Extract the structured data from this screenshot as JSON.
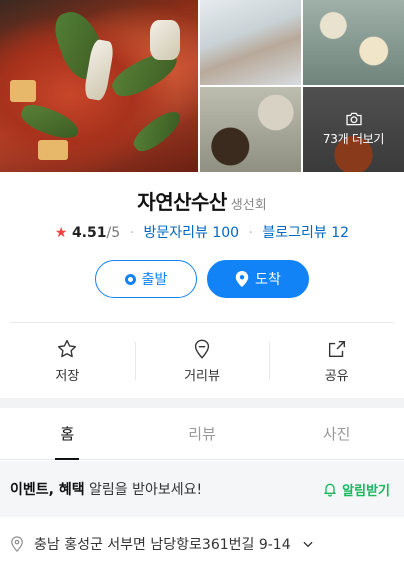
{
  "place": {
    "name": "자연산수산",
    "category": "생선회",
    "rating": "4.51",
    "rating_max": "/5",
    "visitor_reviews": "방문자리뷰 100",
    "blog_reviews": "블로그리뷰 12"
  },
  "photos": {
    "more_label": "73개 더보기"
  },
  "route": {
    "start_label": "출발",
    "arrive_label": "도착"
  },
  "actions": {
    "save_label": "저장",
    "distance_label": "거리뷰",
    "share_label": "공유"
  },
  "tabs": [
    {
      "label": "홈"
    },
    {
      "label": "리뷰"
    },
    {
      "label": "사진"
    }
  ],
  "notice": {
    "strong": "이벤트, 혜택",
    "rest": " 알림을 받아보세요!",
    "button_label": "알림받기"
  },
  "address": {
    "text": "충남 홍성군 서부면 남당항로361번길 9-14"
  },
  "colors": {
    "primary": "#1283f7",
    "link": "#0068c3",
    "star": "#f0423c",
    "notify": "#17b75e"
  }
}
